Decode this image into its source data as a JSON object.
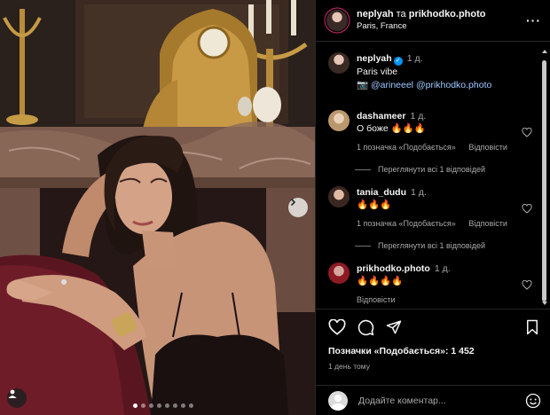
{
  "header": {
    "author": "neplyah",
    "connector": " та ",
    "coauthor": "prikhodko.photo",
    "location": "Paris, France",
    "more_icon": "more-horizontal-icon"
  },
  "caption": {
    "username": "neplyah",
    "time": "1 д.",
    "text": "Paris vibe",
    "camera_emoji": "📷",
    "mention_1": "@arineeel",
    "mention_2": "@prikhodko.photo"
  },
  "comments": [
    {
      "username": "dashameer",
      "time": "1 д.",
      "text": "О боже 🔥🔥🔥",
      "likes": "1 позначка «Подобається»",
      "reply": "Відповісти",
      "view_replies": "Переглянути всі 1 відповідей"
    },
    {
      "username": "tania_dudu",
      "time": "1 д.",
      "text": "🔥🔥🔥",
      "likes": "1 позначка «Подобається»",
      "reply": "Відповісти",
      "view_replies": "Переглянути всі 1 відповідей"
    },
    {
      "username": "prikhodko.photo",
      "time": "1 д.",
      "text": "🔥🔥🔥🔥",
      "reply": "Відповісти"
    }
  ],
  "actions": {
    "likes_text": "Позначки «Подобається»: 1 452",
    "posted_ago": "1 день тому"
  },
  "add_comment": {
    "placeholder": "Додайте коментар..."
  },
  "carousel": {
    "slide_count": 8,
    "active_index": 0
  },
  "colors": {
    "background": "#000000",
    "verified": "#0095f6",
    "secondary_text": "#a8a8a8",
    "divider": "#262626"
  }
}
